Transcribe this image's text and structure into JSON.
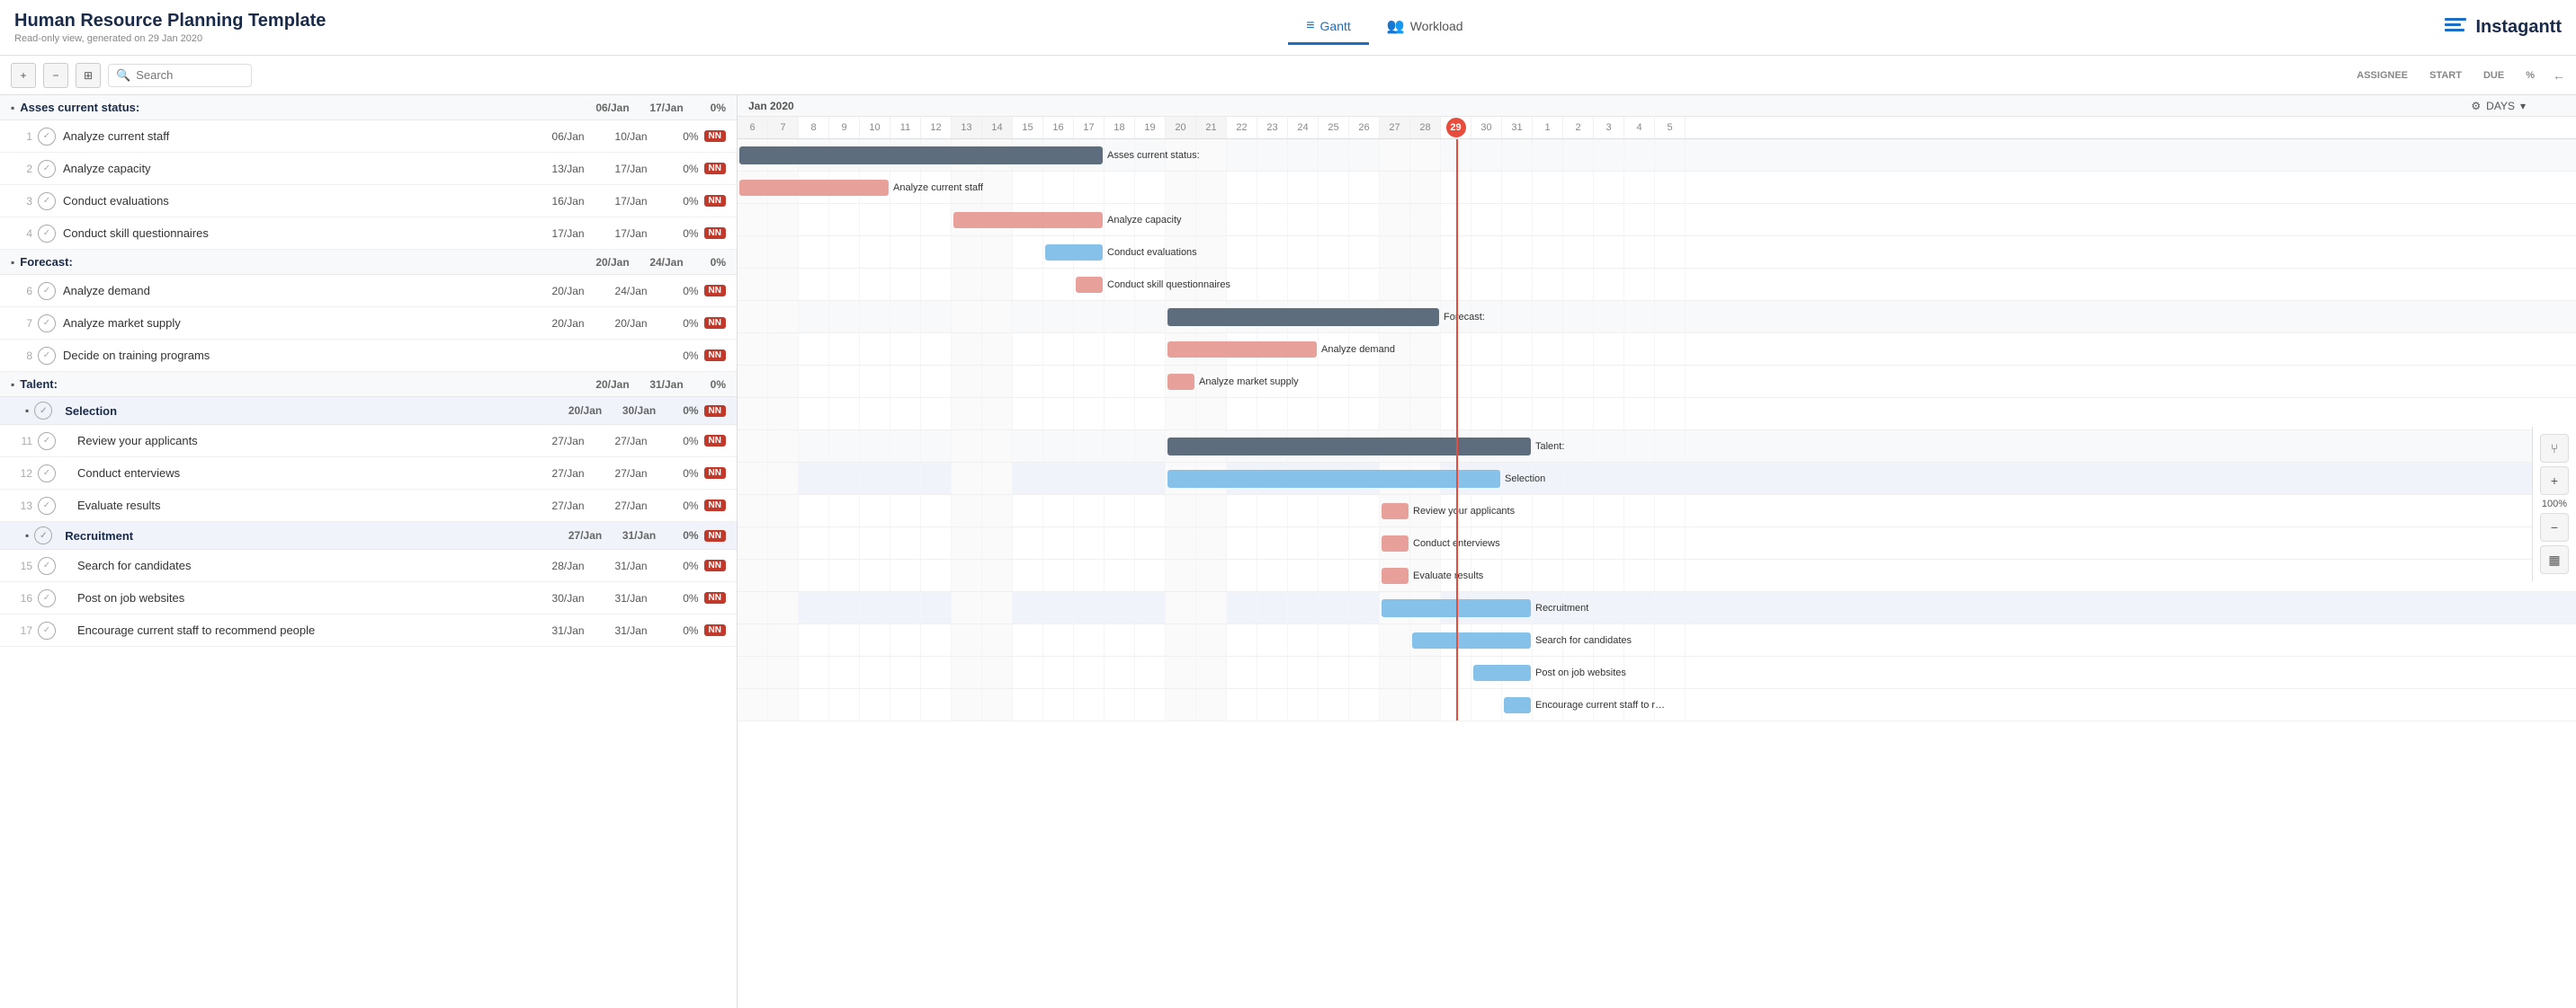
{
  "header": {
    "title": "Human Resource Planning Template",
    "subtitle": "Read-only view, generated on 29 Jan 2020",
    "tabs": [
      {
        "id": "gantt",
        "label": "Gantt",
        "icon": "≡",
        "active": true
      },
      {
        "id": "workload",
        "label": "Workload",
        "icon": "👥",
        "active": false
      }
    ],
    "logo": "Instagantt"
  },
  "toolbar": {
    "expand_icon": "+",
    "collapse_icon": "−",
    "grid_icon": "⊞",
    "search_placeholder": "Search",
    "columns": {
      "assignee": "ASSIGNEE",
      "start": "START",
      "due": "DUE",
      "pct": "%"
    },
    "arrow": "←",
    "days_label": "DAYS"
  },
  "groups": [
    {
      "id": "assess",
      "label": "Asses current status:",
      "start": "06/Jan",
      "due": "17/Jan",
      "pct": "0%",
      "collapsed": false,
      "tasks": [
        {
          "num": 1,
          "name": "Analyze current staff",
          "start": "06/Jan",
          "due": "10/Jan",
          "pct": "0%",
          "tag": "NN",
          "indent": 0
        },
        {
          "num": 2,
          "name": "Analyze capacity",
          "start": "13/Jan",
          "due": "17/Jan",
          "pct": "0%",
          "tag": "NN",
          "indent": 0
        },
        {
          "num": 3,
          "name": "Conduct evaluations",
          "start": "16/Jan",
          "due": "17/Jan",
          "pct": "0%",
          "tag": "NN",
          "indent": 0
        },
        {
          "num": 4,
          "name": "Conduct skill questionnaires",
          "start": "17/Jan",
          "due": "17/Jan",
          "pct": "0%",
          "tag": "NN",
          "indent": 0
        }
      ]
    },
    {
      "id": "forecast",
      "label": "Forecast:",
      "start": "20/Jan",
      "due": "24/Jan",
      "pct": "0%",
      "collapsed": false,
      "tasks": [
        {
          "num": 6,
          "name": "Analyze demand",
          "start": "20/Jan",
          "due": "24/Jan",
          "pct": "0%",
          "tag": "NN",
          "indent": 0
        },
        {
          "num": 7,
          "name": "Analyze market supply",
          "start": "20/Jan",
          "due": "20/Jan",
          "pct": "0%",
          "tag": "NN",
          "indent": 0
        },
        {
          "num": 8,
          "name": "Decide on training programs",
          "start": "",
          "due": "",
          "pct": "0%",
          "tag": "NN",
          "indent": 0
        }
      ]
    },
    {
      "id": "talent",
      "label": "Talent:",
      "start": "20/Jan",
      "due": "31/Jan",
      "pct": "0%",
      "collapsed": false,
      "subgroups": [
        {
          "id": "selection",
          "label": "Selection",
          "start": "20/Jan",
          "due": "30/Jan",
          "pct": "0%",
          "tag": "NN",
          "tasks": [
            {
              "num": 11,
              "name": "Review your applicants",
              "start": "27/Jan",
              "due": "27/Jan",
              "pct": "0%",
              "tag": "NN",
              "indent": 1
            },
            {
              "num": 12,
              "name": "Conduct enterviews",
              "start": "27/Jan",
              "due": "27/Jan",
              "pct": "0%",
              "tag": "NN",
              "indent": 1
            },
            {
              "num": 13,
              "name": "Evaluate results",
              "start": "27/Jan",
              "due": "27/Jan",
              "pct": "0%",
              "tag": "NN",
              "indent": 1
            }
          ]
        },
        {
          "id": "recruitment",
          "label": "Recruitment",
          "start": "27/Jan",
          "due": "31/Jan",
          "pct": "0%",
          "tag": "NN",
          "tasks": [
            {
              "num": 15,
              "name": "Search for candidates",
              "start": "28/Jan",
              "due": "31/Jan",
              "pct": "0%",
              "tag": "NN",
              "indent": 1
            },
            {
              "num": 16,
              "name": "Post on job websites",
              "start": "30/Jan",
              "due": "31/Jan",
              "pct": "0%",
              "tag": "NN",
              "indent": 1
            },
            {
              "num": 17,
              "name": "Encourage current staff to recommend people",
              "start": "31/Jan",
              "due": "31/Jan",
              "pct": "0%",
              "tag": "NN",
              "indent": 1
            }
          ]
        }
      ]
    }
  ],
  "gantt": {
    "month": "Jan 2020",
    "days": [
      6,
      7,
      8,
      9,
      10,
      11,
      12,
      13,
      14,
      15,
      16,
      17,
      18,
      19,
      20,
      21,
      22,
      23,
      24,
      25,
      26,
      27,
      28,
      29,
      30,
      31,
      1,
      2,
      3,
      4,
      5
    ],
    "today_day": 29,
    "zoom": "100%",
    "bars": [
      {
        "row": "assess-group",
        "label": "Asses current status:",
        "type": "dark",
        "col_start": 0,
        "col_span": 12
      },
      {
        "row": "task-1",
        "label": "Analyze current staff",
        "type": "salmon",
        "col_start": 0,
        "col_span": 5
      },
      {
        "row": "task-2",
        "label": "Analyze capacity",
        "type": "salmon",
        "col_start": 7,
        "col_span": 5
      },
      {
        "row": "task-3",
        "label": "Conduct evaluations",
        "type": "blue",
        "col_start": 10,
        "col_span": 2
      },
      {
        "row": "task-4",
        "label": "Conduct skill questionnaires",
        "type": "salmon",
        "col_start": 11,
        "col_span": 1
      },
      {
        "row": "forecast-group",
        "label": "Forecast:",
        "type": "dark",
        "col_start": 14,
        "col_span": 9
      },
      {
        "row": "task-6",
        "label": "Analyze demand",
        "type": "salmon",
        "col_start": 14,
        "col_span": 5
      },
      {
        "row": "task-7",
        "label": "Analyze market supply",
        "type": "salmon",
        "col_start": 14,
        "col_span": 1
      },
      {
        "row": "talent-group",
        "label": "Talent:",
        "type": "dark",
        "col_start": 14,
        "col_span": 16
      },
      {
        "row": "selection-sub",
        "label": "Selection",
        "type": "blue",
        "col_start": 14,
        "col_span": 13
      },
      {
        "row": "task-11",
        "label": "Review your applicants",
        "type": "salmon",
        "col_start": 21,
        "col_span": 1
      },
      {
        "row": "task-12",
        "label": "Conduct enterviews",
        "type": "salmon",
        "col_start": 21,
        "col_span": 1
      },
      {
        "row": "task-13",
        "label": "Evaluate results",
        "type": "salmon",
        "col_start": 21,
        "col_span": 1
      },
      {
        "row": "recruitment-sub",
        "label": "Recruitment",
        "type": "blue",
        "col_start": 21,
        "col_span": 9
      },
      {
        "row": "task-15",
        "label": "Search for candidates",
        "type": "blue",
        "col_start": 22,
        "col_span": 4
      },
      {
        "row": "task-16",
        "label": "Post on job websites",
        "type": "blue",
        "col_start": 24,
        "col_span": 2
      },
      {
        "row": "task-17",
        "label": "Encourage current staff to r",
        "type": "blue",
        "col_start": 25,
        "col_span": 1
      }
    ]
  },
  "tools": {
    "branch_icon": "⑂",
    "zoom_in": "+",
    "zoom_pct": "100%",
    "zoom_out": "−",
    "bar_chart_icon": "▦"
  }
}
